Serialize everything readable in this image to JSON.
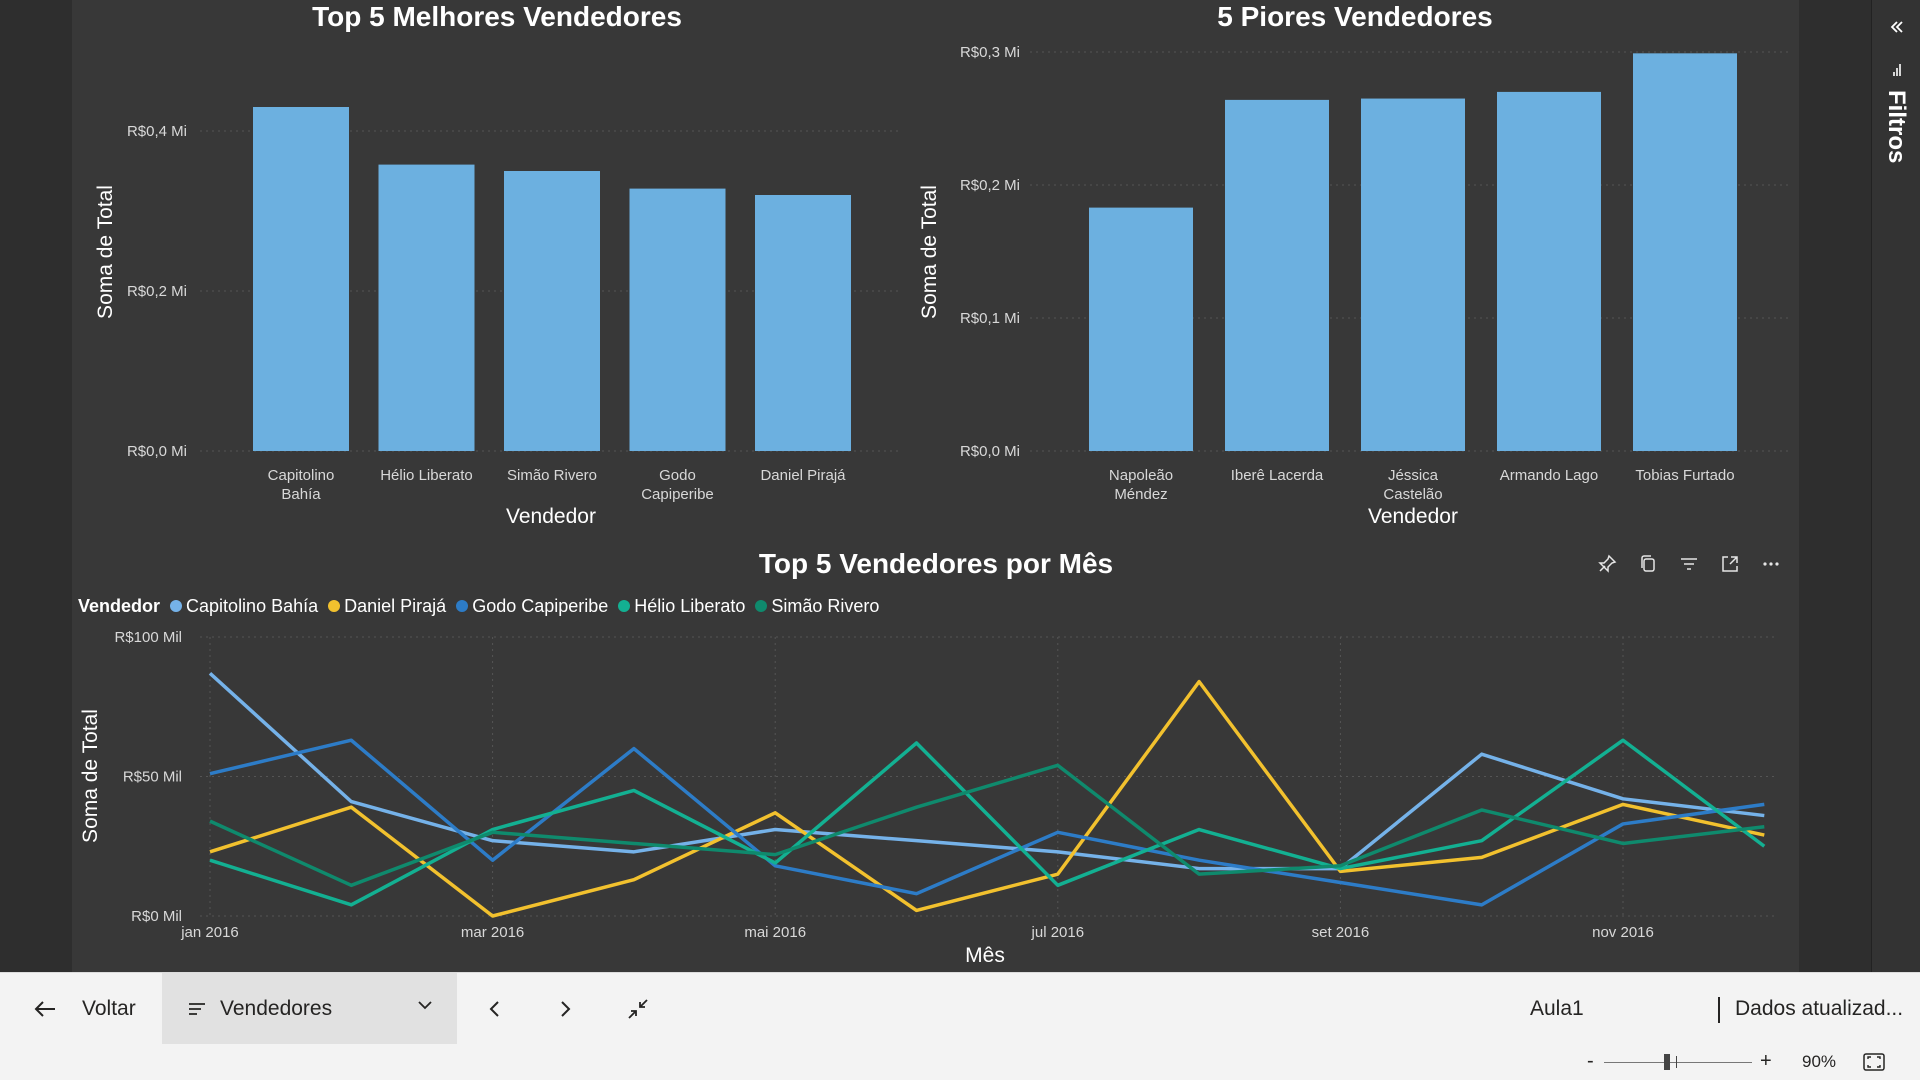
{
  "filters": {
    "label": "Filtros"
  },
  "colors": {
    "bar": "#6cb0e0",
    "series": [
      "#75b2e9",
      "#f2c12e",
      "#2d7cc7",
      "#13b092",
      "#0f8a6d"
    ]
  },
  "chart_data": [
    {
      "id": "top5",
      "type": "bar",
      "title": "Top 5 Melhores Vendedores",
      "xlabel": "Vendedor",
      "ylabel": "Soma de Total",
      "categories": [
        [
          "Capitolino",
          "Bahía"
        ],
        [
          "Hélio Liberato"
        ],
        [
          "Simão Rivero"
        ],
        [
          "Godo",
          "Capiperibe"
        ],
        [
          "Daniel Pirajá"
        ]
      ],
      "values": [
        0.43,
        0.358,
        0.35,
        0.328,
        0.32
      ],
      "ylim": [
        0,
        0.4
      ],
      "yticks": [
        {
          "v": 0,
          "label": "R$0,0 Mi"
        },
        {
          "v": 0.2,
          "label": "R$0,2 Mi"
        },
        {
          "v": 0.4,
          "label": "R$0,4 Mi"
        }
      ]
    },
    {
      "id": "bottom5",
      "type": "bar",
      "title": "5 Piores Vendedores",
      "xlabel": "Vendedor",
      "ylabel": "Soma de Total",
      "categories": [
        [
          "Napoleão",
          "Méndez"
        ],
        [
          "Iberê Lacerda"
        ],
        [
          "Jéssica",
          "Castelão"
        ],
        [
          "Armando Lago"
        ],
        [
          "Tobias Furtado"
        ]
      ],
      "values": [
        0.183,
        0.264,
        0.265,
        0.27,
        0.299
      ],
      "ylim": [
        0,
        0.3
      ],
      "yticks": [
        {
          "v": 0,
          "label": "R$0,0 Mi"
        },
        {
          "v": 0.1,
          "label": "R$0,1 Mi"
        },
        {
          "v": 0.2,
          "label": "R$0,2 Mi"
        },
        {
          "v": 0.3,
          "label": "R$0,3 Mi"
        }
      ]
    },
    {
      "id": "monthly",
      "type": "line",
      "title": "Top 5 Vendedores por Mês",
      "xlabel": "Mês",
      "ylabel": "Soma de Total",
      "legend_title": "Vendedor",
      "legend_position": "top-left",
      "x": [
        "jan 2016",
        "fev 2016",
        "mar 2016",
        "abr 2016",
        "mai 2016",
        "jun 2016",
        "jul 2016",
        "ago 2016",
        "set 2016",
        "out 2016",
        "nov 2016",
        "dez 2016"
      ],
      "xticks": [
        {
          "i": 0,
          "label": "jan 2016"
        },
        {
          "i": 2,
          "label": "mar 2016"
        },
        {
          "i": 4,
          "label": "mai 2016"
        },
        {
          "i": 6,
          "label": "jul 2016"
        },
        {
          "i": 8,
          "label": "set 2016"
        },
        {
          "i": 10,
          "label": "nov 2016"
        }
      ],
      "ylim": [
        0,
        100
      ],
      "yticks": [
        {
          "v": 0,
          "label": "R$0 Mil"
        },
        {
          "v": 50,
          "label": "R$50 Mil"
        },
        {
          "v": 100,
          "label": "R$100 Mil"
        }
      ],
      "series": [
        {
          "name": "Capitolino Bahía",
          "values": [
            87,
            41,
            27,
            23,
            31,
            27,
            23,
            17,
            17,
            58,
            42,
            36
          ]
        },
        {
          "name": "Daniel Pirajá",
          "values": [
            23,
            39,
            0,
            13,
            37,
            2,
            15,
            84,
            16,
            21,
            40,
            29
          ]
        },
        {
          "name": "Godo Capiperibe",
          "values": [
            51,
            63,
            20,
            60,
            18,
            8,
            30,
            20,
            12,
            4,
            33,
            40
          ]
        },
        {
          "name": "Hélio Liberato",
          "values": [
            20,
            4,
            31,
            45,
            19,
            62,
            11,
            31,
            17,
            27,
            63,
            25
          ]
        },
        {
          "name": "Simão Rivero",
          "values": [
            34,
            11,
            30,
            26,
            22,
            39,
            54,
            15,
            18,
            38,
            26,
            32
          ]
        }
      ]
    }
  ],
  "footer": {
    "back_label": "Voltar",
    "page_label": "Vendedores",
    "report_name": "Aula1",
    "data_updated": "Dados atualizad..."
  },
  "statusbar": {
    "zoom_minus": "-",
    "zoom_plus": "+",
    "zoom_value": "90%",
    "zoom_level": 0.9
  }
}
